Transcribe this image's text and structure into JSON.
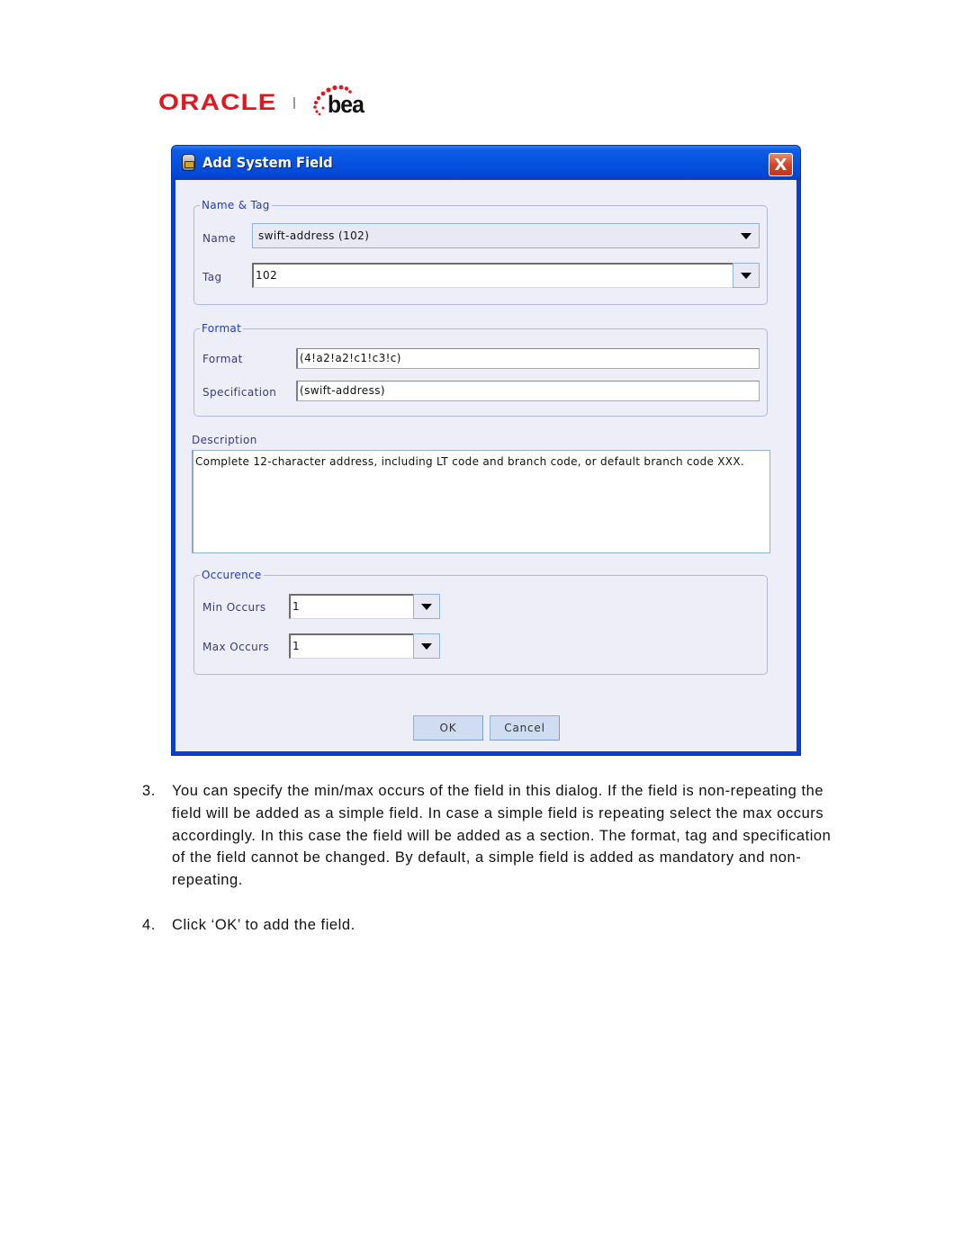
{
  "logo": {
    "oracle": "ORACLE",
    "bea": "bea"
  },
  "dialog": {
    "title": "Add System Field",
    "close_label": "X",
    "groups": {
      "name_tag": {
        "title": "Name & Tag",
        "name_label": "Name",
        "name_value": "swift-address (102)",
        "tag_label": "Tag",
        "tag_value": "102"
      },
      "format": {
        "title": "Format",
        "format_label": "Format",
        "format_value": "(4!a2!a2!c1!c3!c)",
        "spec_label": "Specification",
        "spec_value": "(swift-address)"
      },
      "description": {
        "title": "Description",
        "value": "Complete 12-character address, including LT code and branch code, or default branch code XXX."
      },
      "occurence": {
        "title": "Occurence",
        "min_label": "Min Occurs",
        "min_value": "1",
        "max_label": "Max Occurs",
        "max_value": "1"
      }
    },
    "buttons": {
      "ok": "OK",
      "cancel": "Cancel"
    }
  },
  "document": {
    "steps": [
      {
        "number": "3.",
        "text": "You can specify the min/max occurs of the field in this dialog. If the field is non-repeating the field will be added as a simple field. In case a simple field is repeating select the max occurs accordingly. In this case the field will be added as a section. The format, tag and specification of the field cannot be changed. By default, a simple field is added as mandatory and non-repeating."
      },
      {
        "number": "4.",
        "text": "Click ‘OK’ to add the field."
      }
    ]
  }
}
